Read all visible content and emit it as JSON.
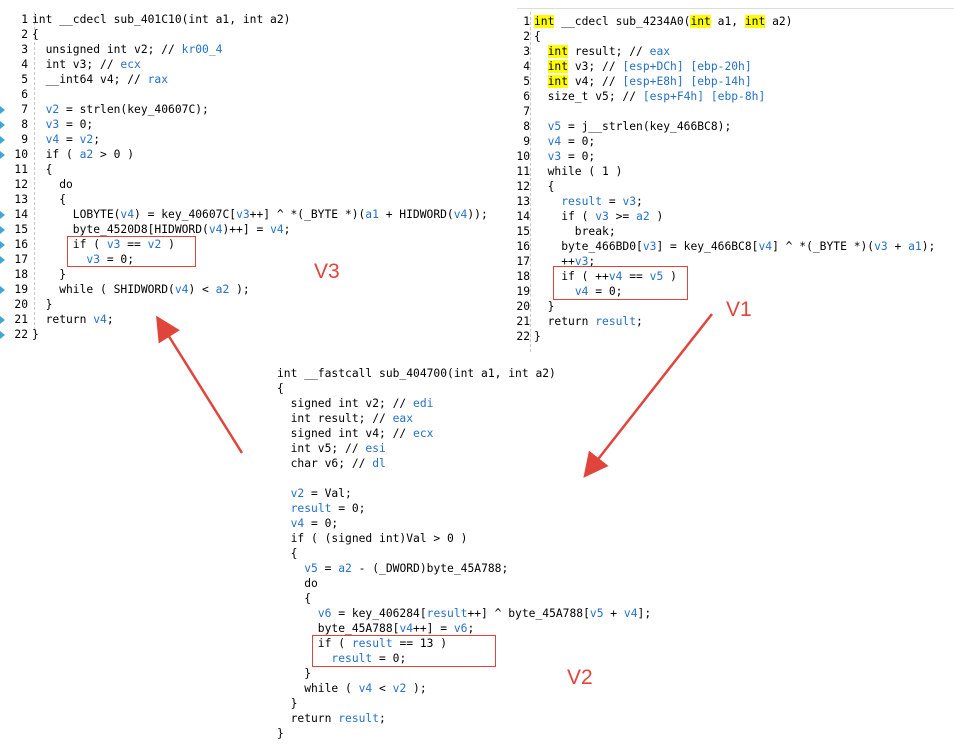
{
  "colors": {
    "annotation": "#e0453c",
    "variable": "#2470c9",
    "highlight": "#ffff00",
    "breakpoint_marker": "#3ea7d8"
  },
  "labels": {
    "v3": "V3",
    "v1": "V1",
    "v2": "V2"
  },
  "left_panel": {
    "lines": [
      {
        "n": "1",
        "html": "int __cdecl sub_401C10(int a1, int a2)"
      },
      {
        "n": "2",
        "html": "{"
      },
      {
        "n": "3",
        "html": "  unsigned int v2; // <span class='v'>kr00_4</span>"
      },
      {
        "n": "4",
        "html": "  int v3; // <span class='v'>ecx</span>"
      },
      {
        "n": "5",
        "html": "  __int64 v4; // <span class='v'>rax</span>"
      },
      {
        "n": "6",
        "html": ""
      },
      {
        "n": "7",
        "marker": true,
        "html": "  <span class='v'>v2</span> = strlen(key_40607C);"
      },
      {
        "n": "8",
        "marker": true,
        "html": "  <span class='v'>v3</span> = 0;"
      },
      {
        "n": "9",
        "marker": true,
        "html": "  <span class='v'>v4</span> = <span class='v'>v2</span>;"
      },
      {
        "n": "10",
        "marker": true,
        "html": "  if ( <span class='v'>a2</span> &gt; 0 )"
      },
      {
        "n": "11",
        "html": "  {"
      },
      {
        "n": "12",
        "html": "    do"
      },
      {
        "n": "13",
        "html": "    {"
      },
      {
        "n": "14",
        "marker": true,
        "html": "      LOBYTE(<span class='v'>v4</span>) = key_40607C[<span class='v'>v3</span>++] ^ *(_BYTE *)(<span class='v'>a1</span> + HIDWORD(<span class='v'>v4</span>));"
      },
      {
        "n": "15",
        "marker": true,
        "html": "      byte_4520D8[HIDWORD(<span class='v'>v4</span>)++] = <span class='v'>v4</span>;"
      },
      {
        "n": "16",
        "marker": true,
        "html": "      if ( <span class='v'>v3</span> == <span class='v'>v2</span> )"
      },
      {
        "n": "17",
        "marker": true,
        "html": "        <span class='v'>v3</span> = 0;"
      },
      {
        "n": "18",
        "html": "    }"
      },
      {
        "n": "19",
        "marker": true,
        "html": "    while ( SHIDWORD(<span class='v'>v4</span>) &lt; <span class='v'>a2</span> );"
      },
      {
        "n": "20",
        "html": "  }"
      },
      {
        "n": "21",
        "marker": true,
        "html": "  return <span class='v'>v4</span>;"
      },
      {
        "n": "22",
        "marker": true,
        "html": "}"
      }
    ]
  },
  "right_panel": {
    "lines": [
      {
        "n": "1",
        "html": "<span class='hl'>int</span> __cdecl sub_4234A0(<span class='hl'>int</span> a1, <span class='hl'>int</span> a2)"
      },
      {
        "n": "2",
        "html": "{"
      },
      {
        "n": "3",
        "html": "  <span class='hl'>int</span> result; // <span class='v'>eax</span>"
      },
      {
        "n": "4",
        "html": "  <span class='hl'>int</span> v3; // <span class='v'>[esp+DCh] [ebp-20h]</span>"
      },
      {
        "n": "5",
        "html": "  <span class='hl'>int</span> v4; // <span class='v'>[esp+E8h] [ebp-14h]</span>"
      },
      {
        "n": "6",
        "html": "  size_t v5; // <span class='v'>[esp+F4h] [ebp-8h]</span>"
      },
      {
        "n": "7",
        "html": ""
      },
      {
        "n": "8",
        "html": "  <span class='v'>v5</span> = j__strlen(key_466BC8);"
      },
      {
        "n": "9",
        "html": "  <span class='v'>v4</span> = 0;"
      },
      {
        "n": "10",
        "html": "  <span class='v'>v3</span> = 0;"
      },
      {
        "n": "11",
        "html": "  while ( 1 )"
      },
      {
        "n": "12",
        "html": "  {"
      },
      {
        "n": "13",
        "html": "    <span class='v'>result</span> = <span class='v'>v3</span>;"
      },
      {
        "n": "14",
        "html": "    if ( <span class='v'>v3</span> &gt;= <span class='v'>a2</span> )"
      },
      {
        "n": "15",
        "html": "      break;"
      },
      {
        "n": "16",
        "html": "    byte_466BD0[<span class='v'>v3</span>] = key_466BC8[<span class='v'>v4</span>] ^ *(_BYTE *)(<span class='v'>v3</span> + <span class='v'>a1</span>);"
      },
      {
        "n": "17",
        "html": "    ++<span class='v'>v3</span>;"
      },
      {
        "n": "18",
        "html": "    if ( ++<span class='v'>v4</span> == <span class='v'>v5</span> )"
      },
      {
        "n": "19",
        "html": "      <span class='v'>v4</span> = 0;"
      },
      {
        "n": "20",
        "html": "  }"
      },
      {
        "n": "21",
        "html": "  return <span class='v'>result</span>;"
      },
      {
        "n": "22",
        "html": "}"
      }
    ]
  },
  "bottom_panel": {
    "lines": [
      {
        "html": "int __fastcall sub_404700(int a1, int a2)"
      },
      {
        "html": "{"
      },
      {
        "html": "  signed int v2; // <span class='v'>edi</span>"
      },
      {
        "html": "  int result; // <span class='v'>eax</span>"
      },
      {
        "html": "  signed int v4; // <span class='v'>ecx</span>"
      },
      {
        "html": "  int v5; // <span class='v'>esi</span>"
      },
      {
        "html": "  char v6; // <span class='v'>dl</span>"
      },
      {
        "html": ""
      },
      {
        "html": "  <span class='v'>v2</span> = Val;"
      },
      {
        "html": "  <span class='v'>result</span> = 0;"
      },
      {
        "html": "  <span class='v'>v4</span> = 0;"
      },
      {
        "html": "  if ( (signed int)Val &gt; 0 )"
      },
      {
        "html": "  {"
      },
      {
        "html": "    <span class='v'>v5</span> = <span class='v'>a2</span> - (_DWORD)byte_45A788;"
      },
      {
        "html": "    do"
      },
      {
        "html": "    {"
      },
      {
        "html": "      <span class='v'>v6</span> = key_406284[<span class='v'>result</span>++] ^ byte_45A788[<span class='v'>v5</span> + <span class='v'>v4</span>];"
      },
      {
        "html": "      byte_45A788[<span class='v'>v4</span>++] = <span class='v'>v6</span>;"
      },
      {
        "html": "      if ( <span class='v'>result</span> == 13 )"
      },
      {
        "html": "        <span class='v'>result</span> = 0;"
      },
      {
        "html": "    }"
      },
      {
        "html": "    while ( <span class='v'>v4</span> &lt; <span class='v'>v2</span> );"
      },
      {
        "html": "  }"
      },
      {
        "html": "  return <span class='v'>result</span>;"
      },
      {
        "html": "}"
      }
    ]
  }
}
